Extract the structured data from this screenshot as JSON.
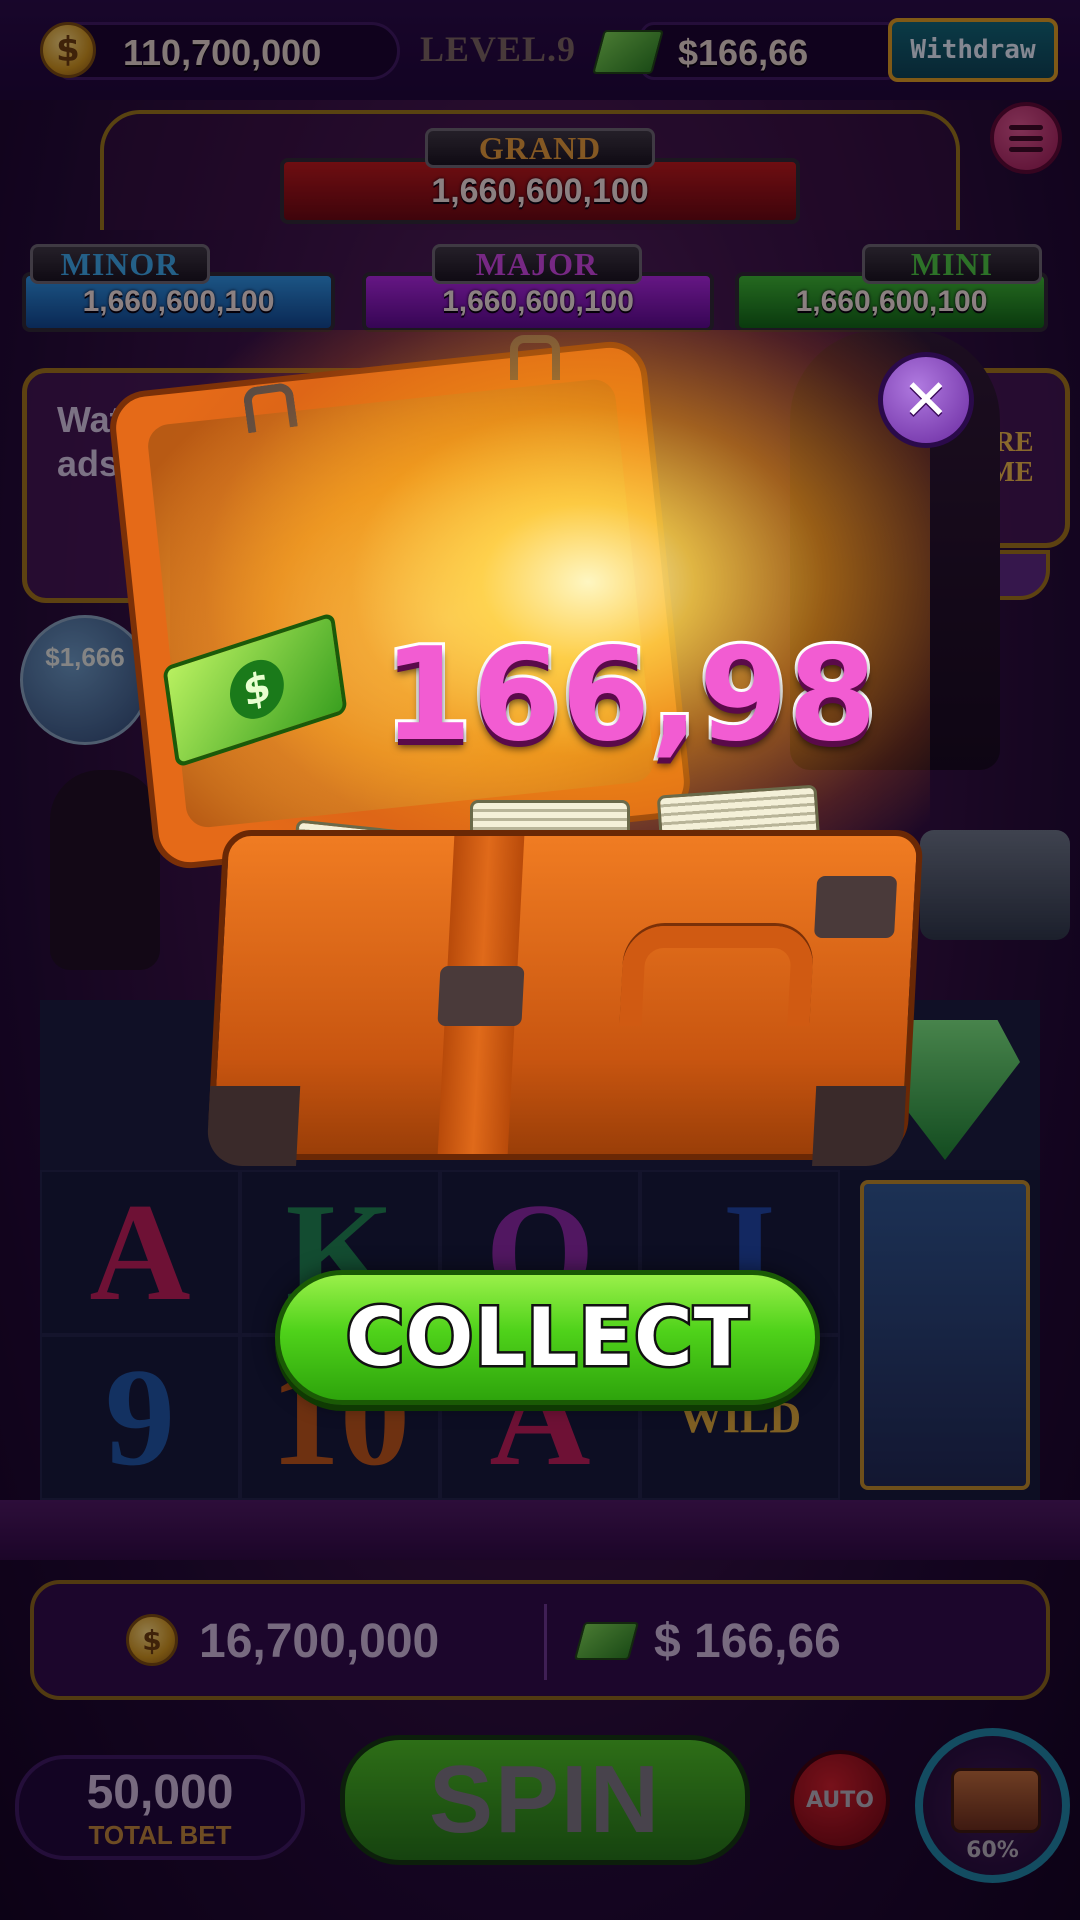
{
  "top_bar": {
    "coins": "110,700,000",
    "level": "LEVEL.9",
    "cash": "$166,66",
    "withdraw_label": "Withdraw"
  },
  "jackpots": {
    "grand": {
      "label": "GRAND",
      "value": "1,660,600,100"
    },
    "minor": {
      "label": "MINOR",
      "value": "1,660,600,100"
    },
    "major": {
      "label": "MAJOR",
      "value": "1,660,600,100"
    },
    "mini": {
      "label": "MINI",
      "value": "1,660,600,100"
    }
  },
  "side_panels": {
    "watch_ads_text": "Watch 30 video ads",
    "bonus_value": "$1,666",
    "more_game_label": "MORE GAME"
  },
  "reels": {
    "symbols": [
      "A",
      "K",
      "Q",
      "J",
      "9",
      "10",
      "A",
      "WILD"
    ]
  },
  "popup": {
    "reward_amount": "166,98",
    "collect_label": "COLLECT"
  },
  "bottom": {
    "coins": "16,700,000",
    "cash": "$ 166,66",
    "total_bet_value": "50,000",
    "total_bet_label": "TOTAL BET",
    "spin_label": "SPIN",
    "auto_label": "AUTO",
    "chest_progress": "60%"
  },
  "colors": {
    "reward_text": "#f25cd2",
    "collect_button": "#4fd21a",
    "close_button": "#8a4ad0",
    "suitcase": "#e8701c"
  }
}
